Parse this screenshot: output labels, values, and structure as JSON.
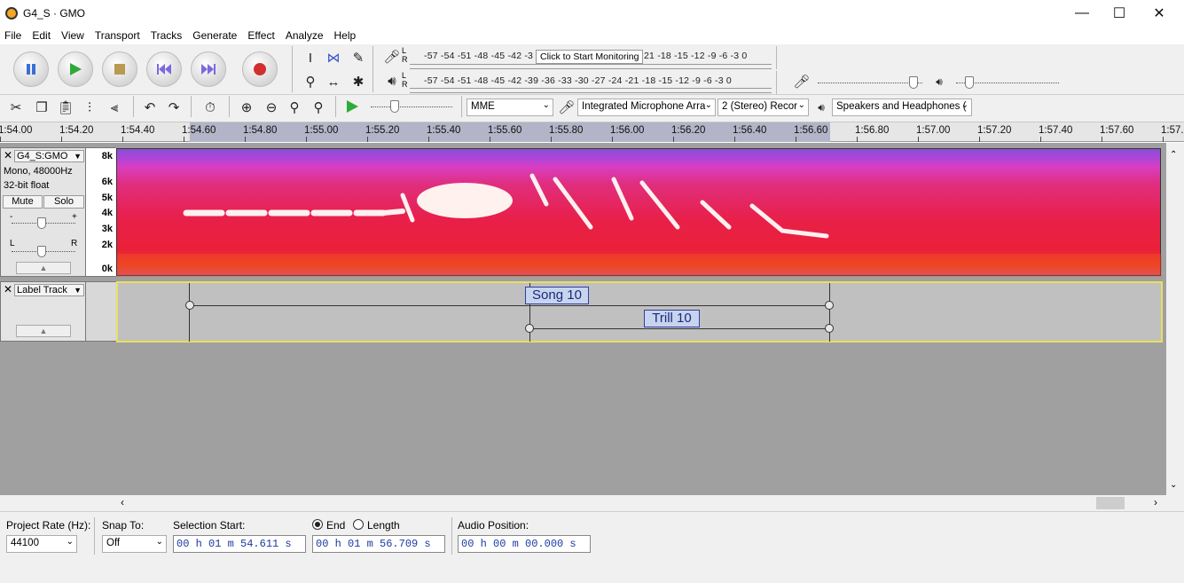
{
  "window": {
    "title": "G4_S · GMO",
    "minimize": "—",
    "maximize": "☐",
    "close": "✕"
  },
  "menu": [
    "File",
    "Edit",
    "View",
    "Transport",
    "Tracks",
    "Generate",
    "Effect",
    "Analyze",
    "Help"
  ],
  "meters": {
    "record_scale": "-57  -54  -51  -48  -45  -42  -3",
    "record_scale_right": "21  -18  -15  -12   -9    -6    -3    0",
    "monitor_tooltip": "Click to Start Monitoring",
    "playback_scale": "-57  -54  -51  -48  -45  -42  -39  -36  -33  -30  -27  -24  -21  -18  -15  -12   -9    -6    -3    0",
    "lr_top": "L",
    "lr_bottom": "R"
  },
  "devices": {
    "host": "MME",
    "recording_device": "Integrated Microphone Arra",
    "channels": "2 (Stereo) Recor",
    "playback_device": "Speakers and Headphones ("
  },
  "ruler": {
    "ticks": [
      "1:54.00",
      "1:54.20",
      "1:54.40",
      "1:54.60",
      "1:54.80",
      "1:55.00",
      "1:55.20",
      "1:55.40",
      "1:55.60",
      "1:55.80",
      "1:56.00",
      "1:56.20",
      "1:56.40",
      "1:56.60",
      "1:56.80",
      "1:57.00",
      "1:57.20",
      "1:57.40",
      "1:57.60",
      "1:57.80"
    ]
  },
  "audio_track": {
    "name": "G4_S:GMO",
    "info1": "Mono, 48000Hz",
    "info2": "32-bit float",
    "mute": "Mute",
    "solo": "Solo",
    "gain_minus": "-",
    "gain_plus": "+",
    "pan_left": "L",
    "pan_right": "R",
    "freq_labels": [
      "8k",
      "6k",
      "5k",
      "4k",
      "3k",
      "2k",
      "0k"
    ]
  },
  "label_track": {
    "name": "Label Track",
    "labels": [
      "Song 10",
      "Trill 10"
    ]
  },
  "bottom": {
    "project_rate_label": "Project Rate (Hz):",
    "project_rate": "44100",
    "snap_to_label": "Snap To:",
    "snap_to": "Off",
    "selection_start_label": "Selection Start:",
    "selection_start": "00 h 01 m 54.611 s",
    "end_label": "End",
    "length_label": "Length",
    "selection_end": "00 h 01 m 56.709 s",
    "audio_position_label": "Audio Position:",
    "audio_position": "00 h 00 m 00.000 s"
  }
}
